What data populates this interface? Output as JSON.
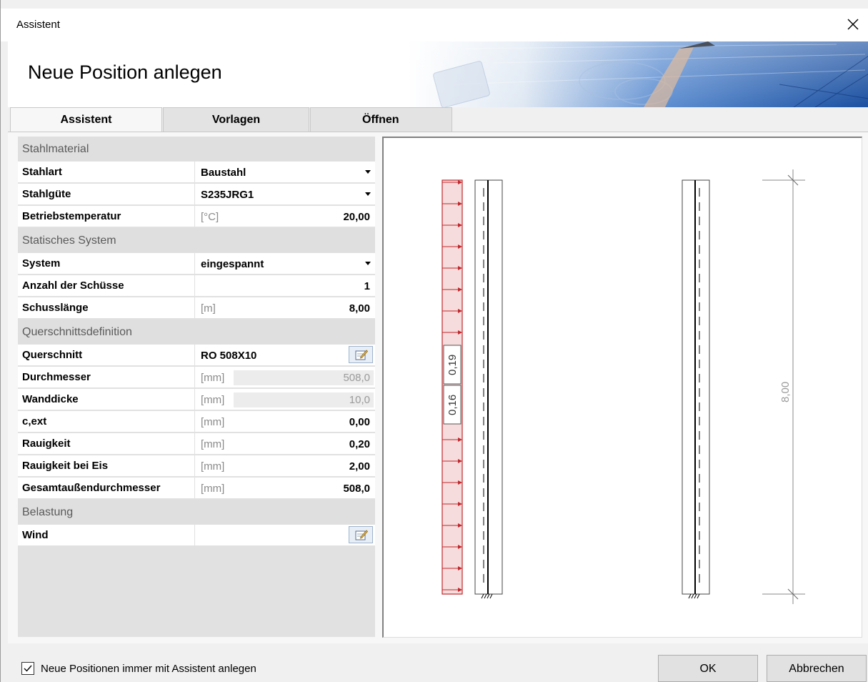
{
  "window": {
    "title": "Assistent"
  },
  "header": {
    "heading": "Neue Position anlegen"
  },
  "tabs": [
    {
      "label": "Assistent",
      "active": true
    },
    {
      "label": "Vorlagen",
      "active": false
    },
    {
      "label": "Öffnen",
      "active": false
    }
  ],
  "sections": {
    "stahlmaterial": "Stahlmaterial",
    "statisches_system": "Statisches System",
    "querschnitt": "Querschnittsdefinition",
    "belastung": "Belastung"
  },
  "rows": {
    "stahlart": {
      "label": "Stahlart",
      "value": "Baustahl"
    },
    "stahlguete": {
      "label": "Stahlgüte",
      "value": "S235JRG1"
    },
    "betriebstemperatur": {
      "label": "Betriebstemperatur",
      "unit": "[°C]",
      "value": "20,00"
    },
    "system": {
      "label": "System",
      "value": "eingespannt"
    },
    "anzahl": {
      "label": "Anzahl der Schüsse",
      "value": "1"
    },
    "schusslaenge": {
      "label": "Schusslänge",
      "unit": "[m]",
      "value": "8,00"
    },
    "querschnitt": {
      "label": "Querschnitt",
      "value": "RO 508X10"
    },
    "durchmesser": {
      "label": "Durchmesser",
      "unit": "[mm]",
      "value": "508,0"
    },
    "wanddicke": {
      "label": "Wanddicke",
      "unit": "[mm]",
      "value": "10,0"
    },
    "cext": {
      "label": "c,ext",
      "unit": "[mm]",
      "value": "0,00"
    },
    "rauigkeit": {
      "label": "Rauigkeit",
      "unit": "[mm]",
      "value": "0,20"
    },
    "rauigkeit_eis": {
      "label": "Rauigkeit bei Eis",
      "unit": "[mm]",
      "value": "2,00"
    },
    "gesamt": {
      "label": "Gesamtaußendurchmesser",
      "unit": "[mm]",
      "value": "508,0"
    },
    "wind": {
      "label": "Wind",
      "value": ""
    }
  },
  "preview": {
    "load_label_1": "0,19",
    "load_label_2": "0,16",
    "dimension_label": "8,00"
  },
  "footer": {
    "checkbox_label": "Neue Positionen immer mit Assistent anlegen",
    "checkbox_checked": true,
    "ok_label": "OK",
    "cancel_label": "Abbrechen"
  },
  "colors": {
    "load_red": "#c0282d",
    "load_fill": "#f6dcdc"
  },
  "icons": [
    "close-icon",
    "edit-icon",
    "check-icon",
    "dropdown-arrow-icon"
  ]
}
